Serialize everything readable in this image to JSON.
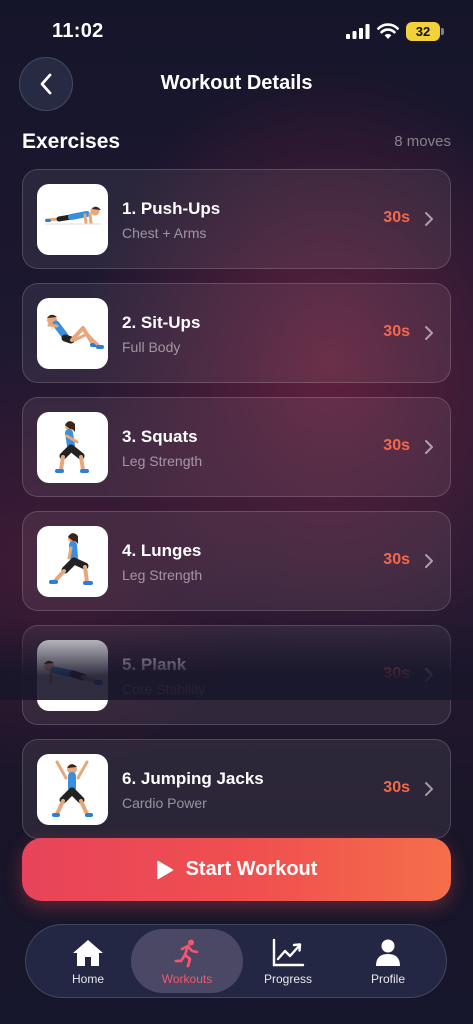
{
  "status_bar": {
    "time": "11:02",
    "battery": "32"
  },
  "header": {
    "title": "Workout Details"
  },
  "section": {
    "title": "Exercises",
    "count": "8 moves"
  },
  "exercises": [
    {
      "name": "1. Push-Ups",
      "subtitle": "Chest + Arms",
      "duration": "30s",
      "icon": "push-up-figure"
    },
    {
      "name": "2. Sit-Ups",
      "subtitle": "Full Body",
      "duration": "30s",
      "icon": "sit-up-figure"
    },
    {
      "name": "3. Squats",
      "subtitle": "Leg Strength",
      "duration": "30s",
      "icon": "squat-figure"
    },
    {
      "name": "4. Lunges",
      "subtitle": "Leg Strength",
      "duration": "30s",
      "icon": "lunge-figure"
    },
    {
      "name": "5. Plank",
      "subtitle": "Core Stability",
      "duration": "30s",
      "icon": "plank-figure"
    },
    {
      "name": "6. Jumping Jacks",
      "subtitle": "Cardio Power",
      "duration": "30s",
      "icon": "jumping-jack-figure"
    }
  ],
  "start_button": {
    "label": "Start Workout"
  },
  "tab_bar": {
    "items": [
      {
        "label": "Home",
        "icon": "home-icon"
      },
      {
        "label": "Workouts",
        "icon": "running-icon",
        "active": true
      },
      {
        "label": "Progress",
        "icon": "chart-icon"
      },
      {
        "label": "Profile",
        "icon": "person-icon"
      }
    ]
  },
  "colors": {
    "accent": "#f2694e",
    "start_gradient_from": "#e8435a",
    "start_gradient_to": "#f56e4a",
    "active_tab": "#f3566e"
  }
}
